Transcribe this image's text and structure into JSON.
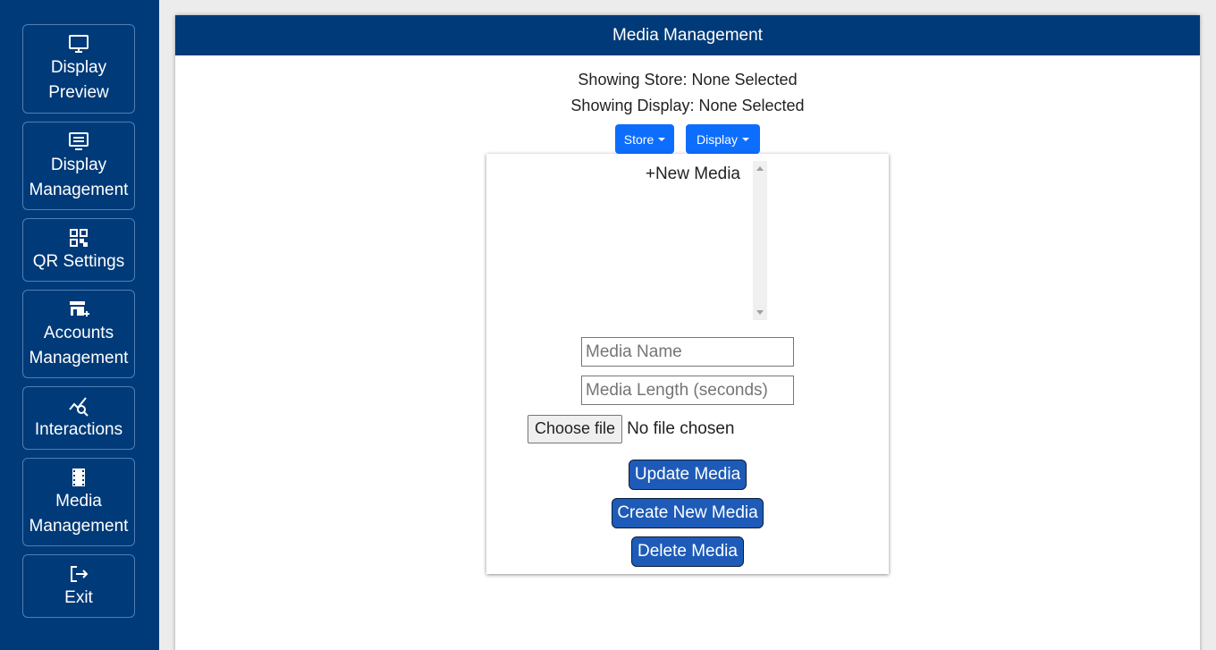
{
  "sidebar": {
    "items": [
      {
        "label": "Display\nPreview",
        "icon": "monitor-icon"
      },
      {
        "label": "Display\nManagement",
        "icon": "display-settings-icon"
      },
      {
        "label": "QR Settings",
        "icon": "qr-code-icon"
      },
      {
        "label": "Accounts\nManagement",
        "icon": "store-add-icon"
      },
      {
        "label": "Interactions",
        "icon": "chart-search-icon"
      },
      {
        "label": "Media\nManagement",
        "icon": "film-icon"
      },
      {
        "label": "Exit",
        "icon": "logout-icon"
      }
    ]
  },
  "header": {
    "title": "Media Management"
  },
  "status": {
    "store": "Showing Store: None Selected",
    "display": "Showing Display: None Selected"
  },
  "dropdowns": {
    "store_label": "Store",
    "display_label": "Display"
  },
  "media_list": {
    "items": [
      "+New Media"
    ]
  },
  "form": {
    "media_name_placeholder": "Media Name",
    "media_length_placeholder": "Media Length (seconds)",
    "choose_file_label": "Choose file",
    "file_status": "No file chosen"
  },
  "actions": {
    "update": "Update Media",
    "create": "Create New Media",
    "delete": "Delete Media"
  },
  "colors": {
    "brand_navy": "#003a78",
    "primary_blue": "#0d6efd",
    "action_blue": "#1e5bb8"
  }
}
